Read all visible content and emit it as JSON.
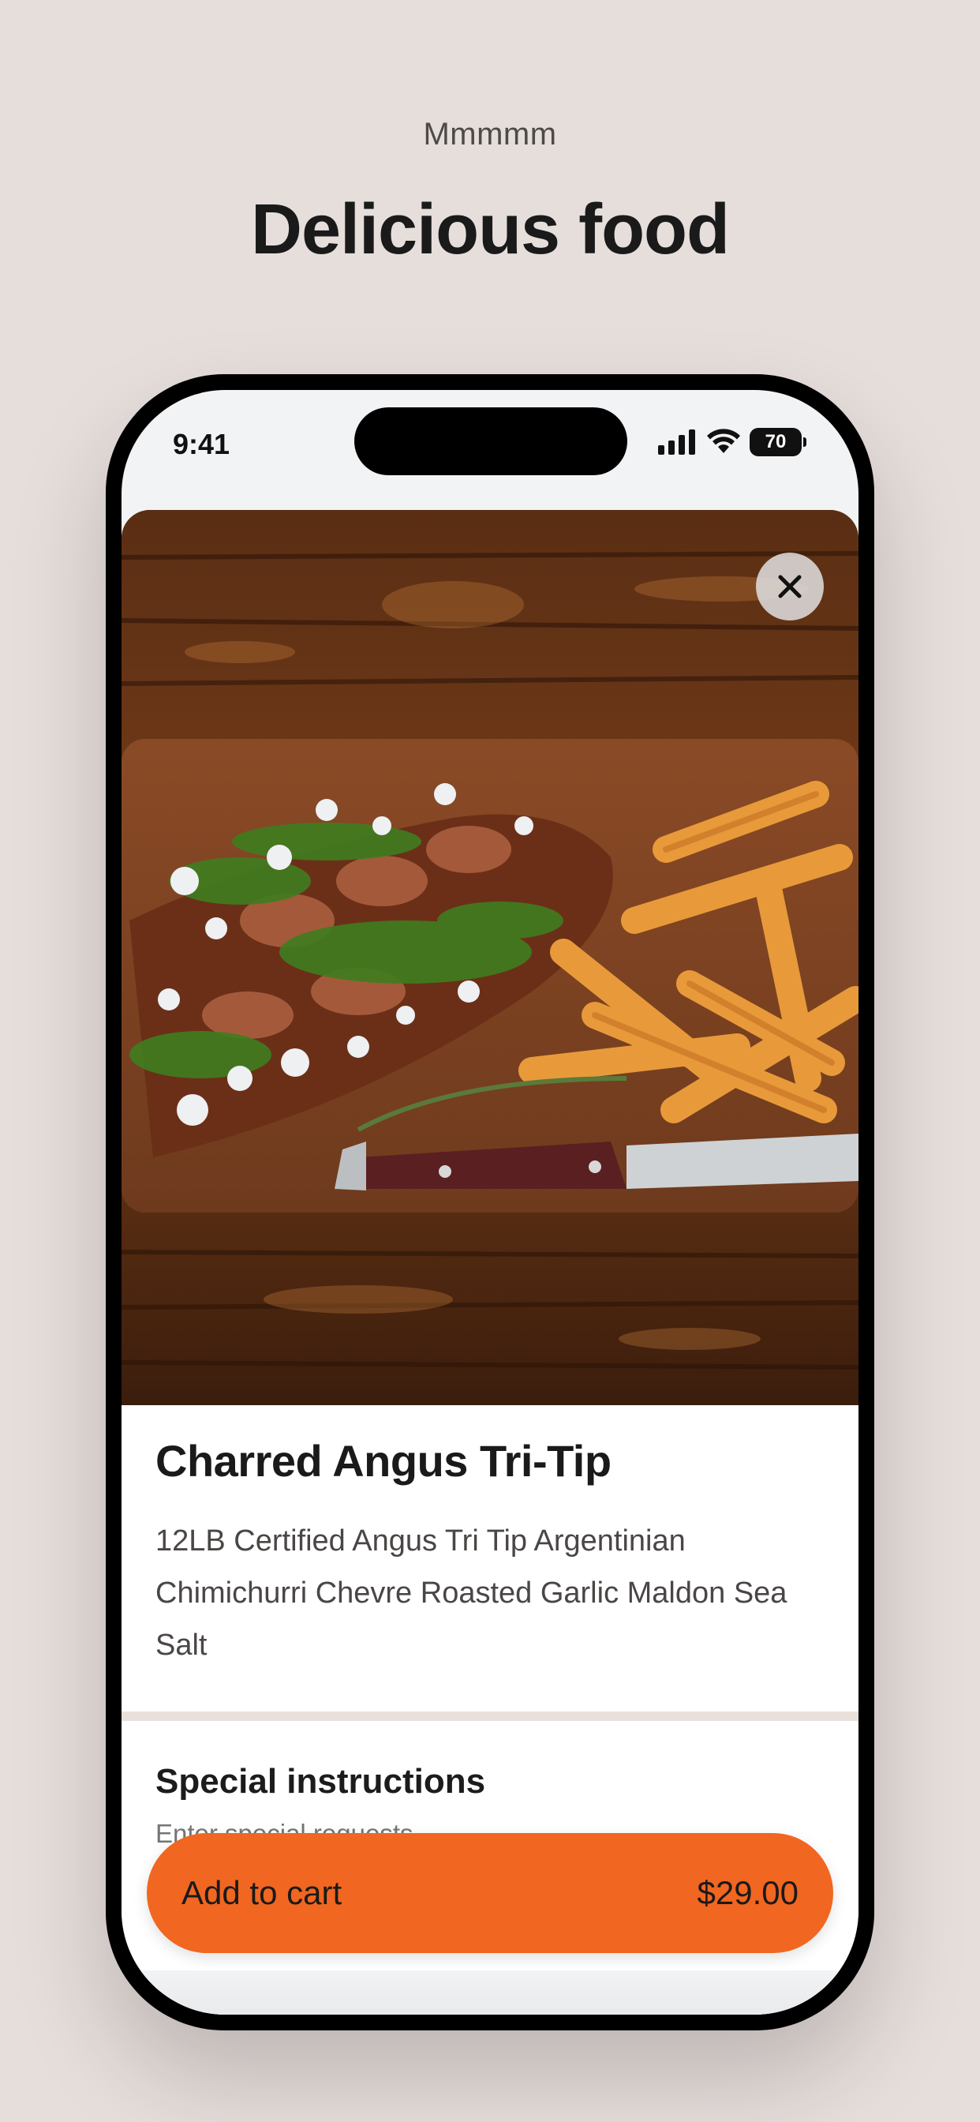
{
  "header": {
    "eyebrow": "Mmmmm",
    "title": "Delicious food"
  },
  "status_bar": {
    "time": "9:41",
    "battery": "70",
    "icons": [
      "signal-icon",
      "wifi-icon",
      "battery-icon"
    ]
  },
  "product": {
    "name": "Charred Angus Tri-Tip",
    "description": "12LB Certified Angus Tri Tip Argentinian Chimichurri Chevre Roasted Garlic Maldon Sea Salt",
    "image_alt": "Sliced tri-tip steak with chimichurri, crumbled cheese, greens and french fries on a wooden board",
    "close_icon": "close-icon"
  },
  "instructions": {
    "title": "Special instructions",
    "placeholder": "Enter special requests"
  },
  "cta": {
    "label": "Add to cart",
    "price": "$29.00"
  },
  "colors": {
    "background": "#e6dedb",
    "accent": "#f16620",
    "text": "#1a1a1a"
  }
}
